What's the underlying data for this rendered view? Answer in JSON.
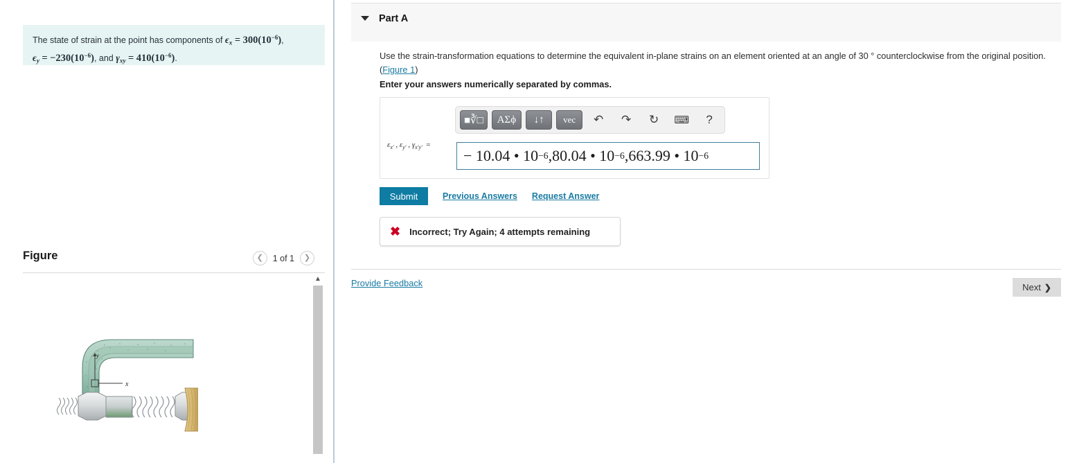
{
  "left": {
    "problem_statement": {
      "lead": "The state of strain at the point has components of",
      "eps_x_sym": "ϵ",
      "eps_x_sub": "x",
      "eps_x_value": "300(10",
      "exp": "−6",
      "eps_y_sym": "ϵ",
      "eps_y_sub": "y",
      "eps_y_value": "−230(10",
      "and_word": ", and",
      "gamma_sym": "γ",
      "gamma_sub": "xy",
      "gamma_value": "410(10"
    },
    "figure": {
      "title": "Figure",
      "prev_icon": "chevron-left-icon",
      "count_label": "1 of 1",
      "next_icon": "chevron-right-icon",
      "scrollbar_up_icon": "chevron-up-icon",
      "alt": "Bent wrench tightening a bolt with nut against a wooden board, showing x and y axes at a point on the wrench",
      "axis_x_label": "x",
      "axis_y_label": "y"
    }
  },
  "right": {
    "part": {
      "caret_icon": "caret-down-icon",
      "label": "Part A"
    },
    "question": {
      "text_before_link": "Use the strain-transformation equations to determine the equivalent in-plane strains on an element oriented at an angle of 30 ° counterclockwise from the original position.",
      "figure_link": "Figure 1",
      "instruction": "Enter your answers numerically separated by commas."
    },
    "math_toolbar": {
      "buttons": [
        {
          "name": "math-template-button",
          "label": "■√□",
          "icon": "sqrt-template-icon"
        },
        {
          "name": "greek-letters-button",
          "label": "ΑΣϕ",
          "icon": "greek-icon"
        },
        {
          "name": "arrows-button",
          "label": "↓↑",
          "icon": "up-down-arrows-icon"
        },
        {
          "name": "vector-button",
          "label": "vec",
          "icon": "vector-icon"
        }
      ],
      "icons": [
        {
          "name": "undo-button",
          "glyph": "↶",
          "icon": "undo-icon"
        },
        {
          "name": "redo-button",
          "glyph": "↷",
          "icon": "redo-icon"
        },
        {
          "name": "reset-button",
          "glyph": "↻",
          "icon": "reset-icon"
        },
        {
          "name": "keyboard-button",
          "glyph": "⌨",
          "icon": "keyboard-icon"
        },
        {
          "name": "help-button",
          "glyph": "?",
          "icon": "help-icon"
        }
      ]
    },
    "answer": {
      "label": "ϵx′ , ϵy′ , γx′y′  =",
      "value": "− 10.04 • 10⁻⁶,80.04 • 10⁻⁶,663.99 • 10⁻⁶",
      "v1": "− 10.04 • 10",
      "v1_exp": "−6",
      "v2": ",80.04 • 10",
      "v2_exp": "−6",
      "v3": ",663.99 • 10",
      "v3_exp": "−6"
    },
    "actions": {
      "submit_label": "Submit",
      "previous_answers_label": "Previous Answers",
      "request_answer_label": "Request Answer"
    },
    "feedback": {
      "icon": "error-x-icon",
      "message": "Incorrect; Try Again; 4 attempts remaining"
    },
    "footer": {
      "provide_feedback_label": "Provide Feedback",
      "next_label": "Next",
      "next_icon": "chevron-right-icon"
    }
  },
  "colors": {
    "accent_teal": "#0e7ca3",
    "link_blue": "#1a7ba3",
    "error_red": "#cc0022",
    "problem_box_bg": "#e7f4f4",
    "panel_gray": "#f7f7f7"
  }
}
